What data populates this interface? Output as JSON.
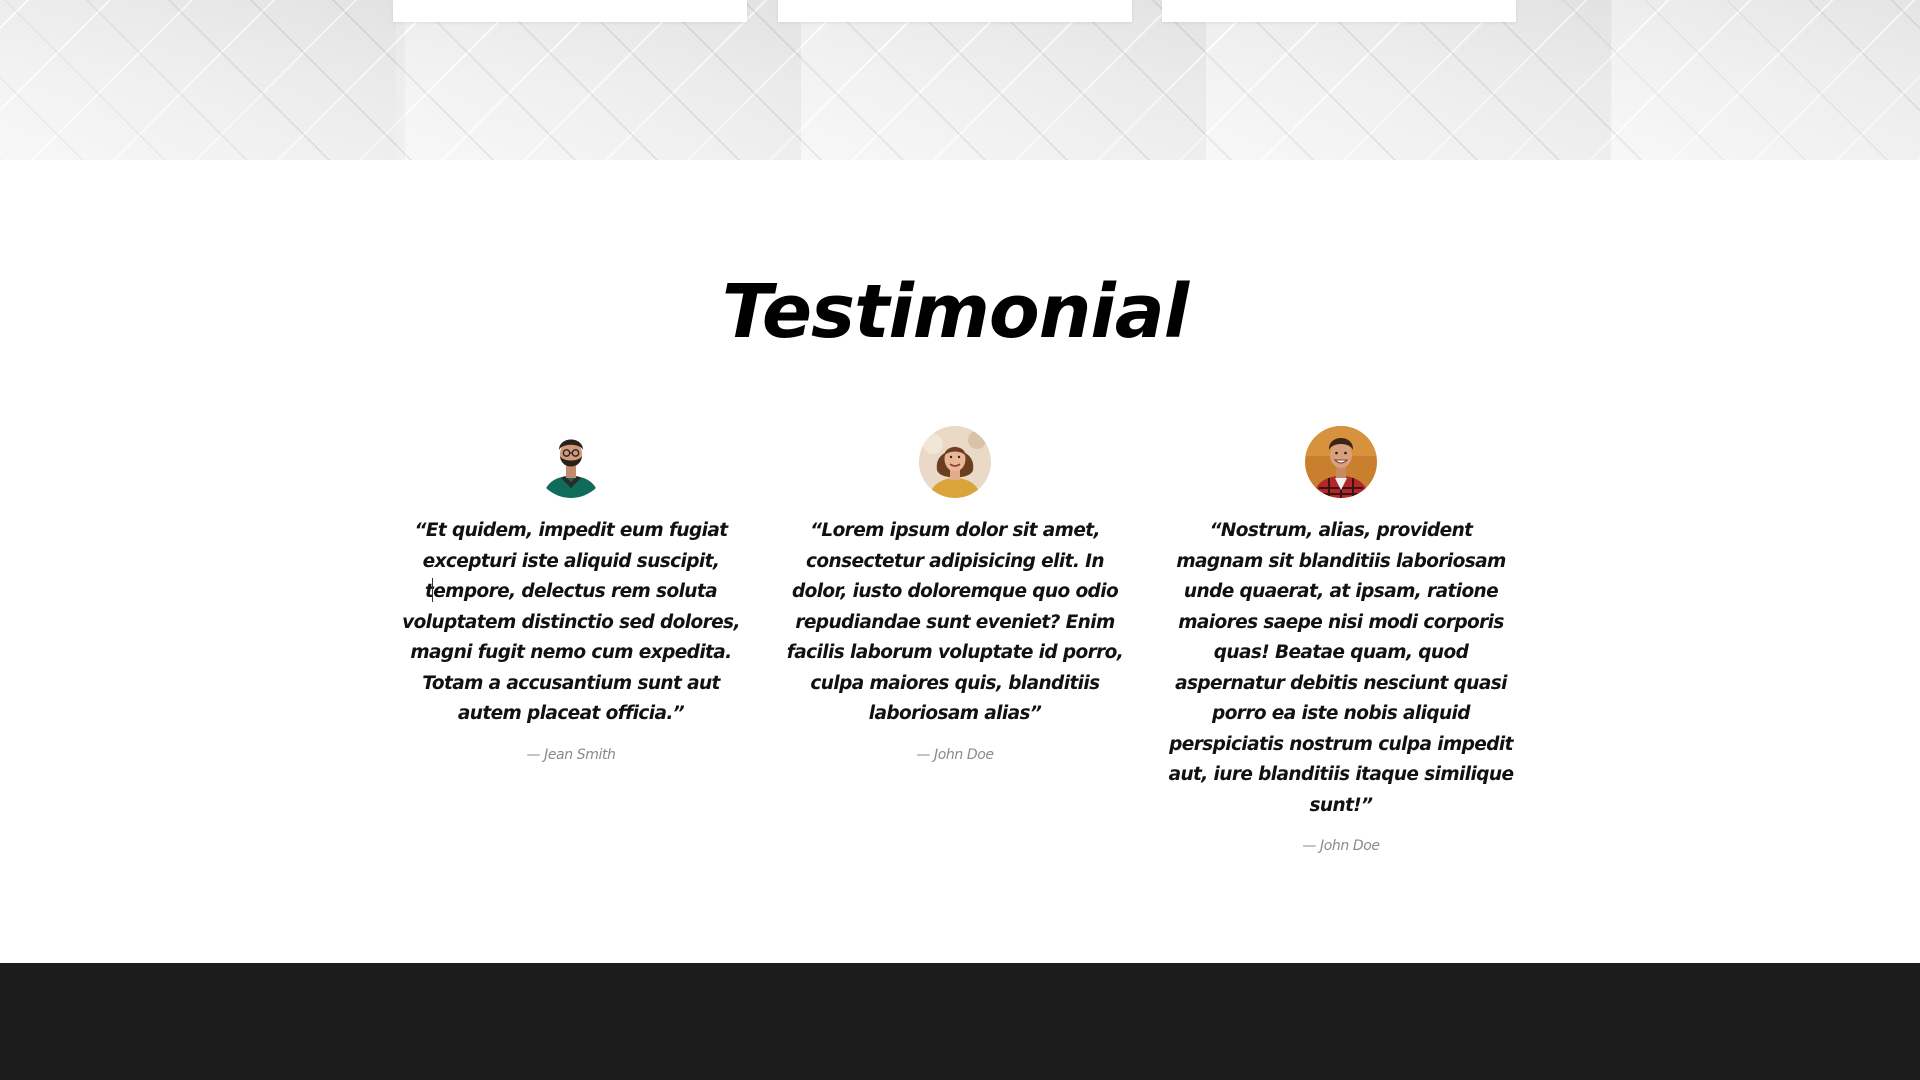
{
  "section": {
    "title": "Testimonial"
  },
  "testimonials": [
    {
      "quote": "“Et quidem, impedit eum fugiat excepturi iste aliquid suscipit, tempore, delectus rem soluta voluptatem distinctio sed dolores, magni fugit nemo cum expedita. Totam a accusantium sunt aut autem placeat officia.”",
      "author": "— Jean Smith"
    },
    {
      "quote": "“Lorem ipsum dolor sit amet, consectetur adipisicing elit. In dolor, iusto doloremque quo odio repudiandae sunt eveniet? Enim facilis laborum voluptate id porro, culpa maiores quis, blanditiis laboriosam alias”",
      "author": "— John Doe"
    },
    {
      "quote": "“Nostrum, alias, provident magnam sit blanditiis laboriosam unde quaerat, at ipsam, ratione maiores saepe nisi modi corporis quas! Beatae quam, quod aspernatur debitis nesciunt quasi porro ea iste nobis aliquid perspiciatis nostrum culpa impedit aut, iure blanditiis itaque similique sunt!”",
      "author": "— John Doe"
    }
  ],
  "colors": {
    "footer_bg": "#1c1c1d",
    "text": "#111111",
    "author": "#8a8a8a"
  },
  "icons": {
    "avatar_1": "avatar-bearded-man-icon",
    "avatar_2": "avatar-woman-icon",
    "avatar_3": "avatar-smiling-man-icon"
  }
}
